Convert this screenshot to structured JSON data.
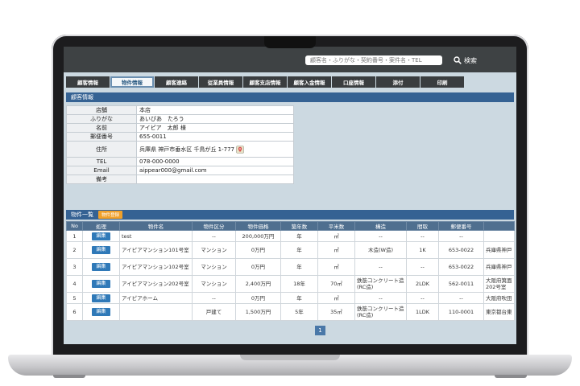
{
  "search": {
    "placeholder": "顧客名・ふりがな・契約番号・案件名・TEL",
    "button_label": "検索"
  },
  "tabs": [
    "顧客情報",
    "物件情報",
    "顧客連絡",
    "従業員情報",
    "顧客支店情報",
    "顧客入金情報",
    "口座情報",
    "添付",
    "印刷"
  ],
  "active_tab": "物件情報",
  "customer": {
    "section_title": "顧客情報",
    "rows": [
      {
        "label": "店舗",
        "value": "本店"
      },
      {
        "label": "ふりがな",
        "value": "あいぴあ　たろう"
      },
      {
        "label": "名前",
        "value": "アイピア　太郎 様"
      },
      {
        "label": "郵便番号",
        "value": "655-0011"
      },
      {
        "label": "住所",
        "value": "兵庫県 神戸市垂水区 千鳥が丘 1-777"
      },
      {
        "label": "TEL",
        "value": "078-000-0000"
      },
      {
        "label": "Email",
        "value": "aippear000@gmail.com"
      },
      {
        "label": "備考",
        "value": ""
      }
    ]
  },
  "properties": {
    "section_title": "物件一覧",
    "register_label": "物件登録",
    "columns": [
      "No",
      "処理",
      "物件名",
      "物件区分",
      "物件価格",
      "築年数",
      "平米数",
      "構造",
      "間取",
      "郵便番号",
      ""
    ],
    "edit_label": "編集",
    "rows": [
      {
        "no": "1",
        "name": "test",
        "type": "--",
        "price": "200,000万円",
        "age": "年",
        "area": "㎡",
        "structure": "--",
        "layout": "--",
        "zip": "--",
        "addr": ""
      },
      {
        "no": "2",
        "name": "アイピアマンション101号室",
        "type": "マンション",
        "price": "0万円",
        "age": "年",
        "area": "㎡",
        "structure": "木造(W造)",
        "layout": "1K",
        "zip": "653-0022",
        "addr": "兵庫県神戸"
      },
      {
        "no": "3",
        "name": "アイピアマンション102号室",
        "type": "マンション",
        "price": "0万円",
        "age": "年",
        "area": "㎡",
        "structure": "--",
        "layout": "--",
        "zip": "653-0022",
        "addr": "兵庫県神戸"
      },
      {
        "no": "4",
        "name": "アイピアマンション202号室",
        "type": "マンション",
        "price": "2,400万円",
        "age": "18年",
        "area": "70㎡",
        "structure": "鉄筋コンクリート造(RC造)",
        "layout": "2LDK",
        "zip": "562-0011",
        "addr": "大阪府箕面 202号室"
      },
      {
        "no": "5",
        "name": "アイピアホーム",
        "type": "--",
        "price": "0万円",
        "age": "年",
        "area": "㎡",
        "structure": "--",
        "layout": "--",
        "zip": "--",
        "addr": "大阪府吹田"
      },
      {
        "no": "6",
        "name": "",
        "type": "戸建て",
        "price": "1,500万円",
        "age": "5年",
        "area": "35㎡",
        "structure": "鉄筋コンクリート造(RC造)",
        "layout": "1LDK",
        "zip": "110-0001",
        "addr": "東京都台東"
      }
    ]
  },
  "pagination": {
    "current": "1"
  },
  "colors": {
    "header_blue": "#356293",
    "edit_blue": "#2f79b8",
    "badge_orange": "#f0a02a",
    "topbar": "#3e4244"
  }
}
